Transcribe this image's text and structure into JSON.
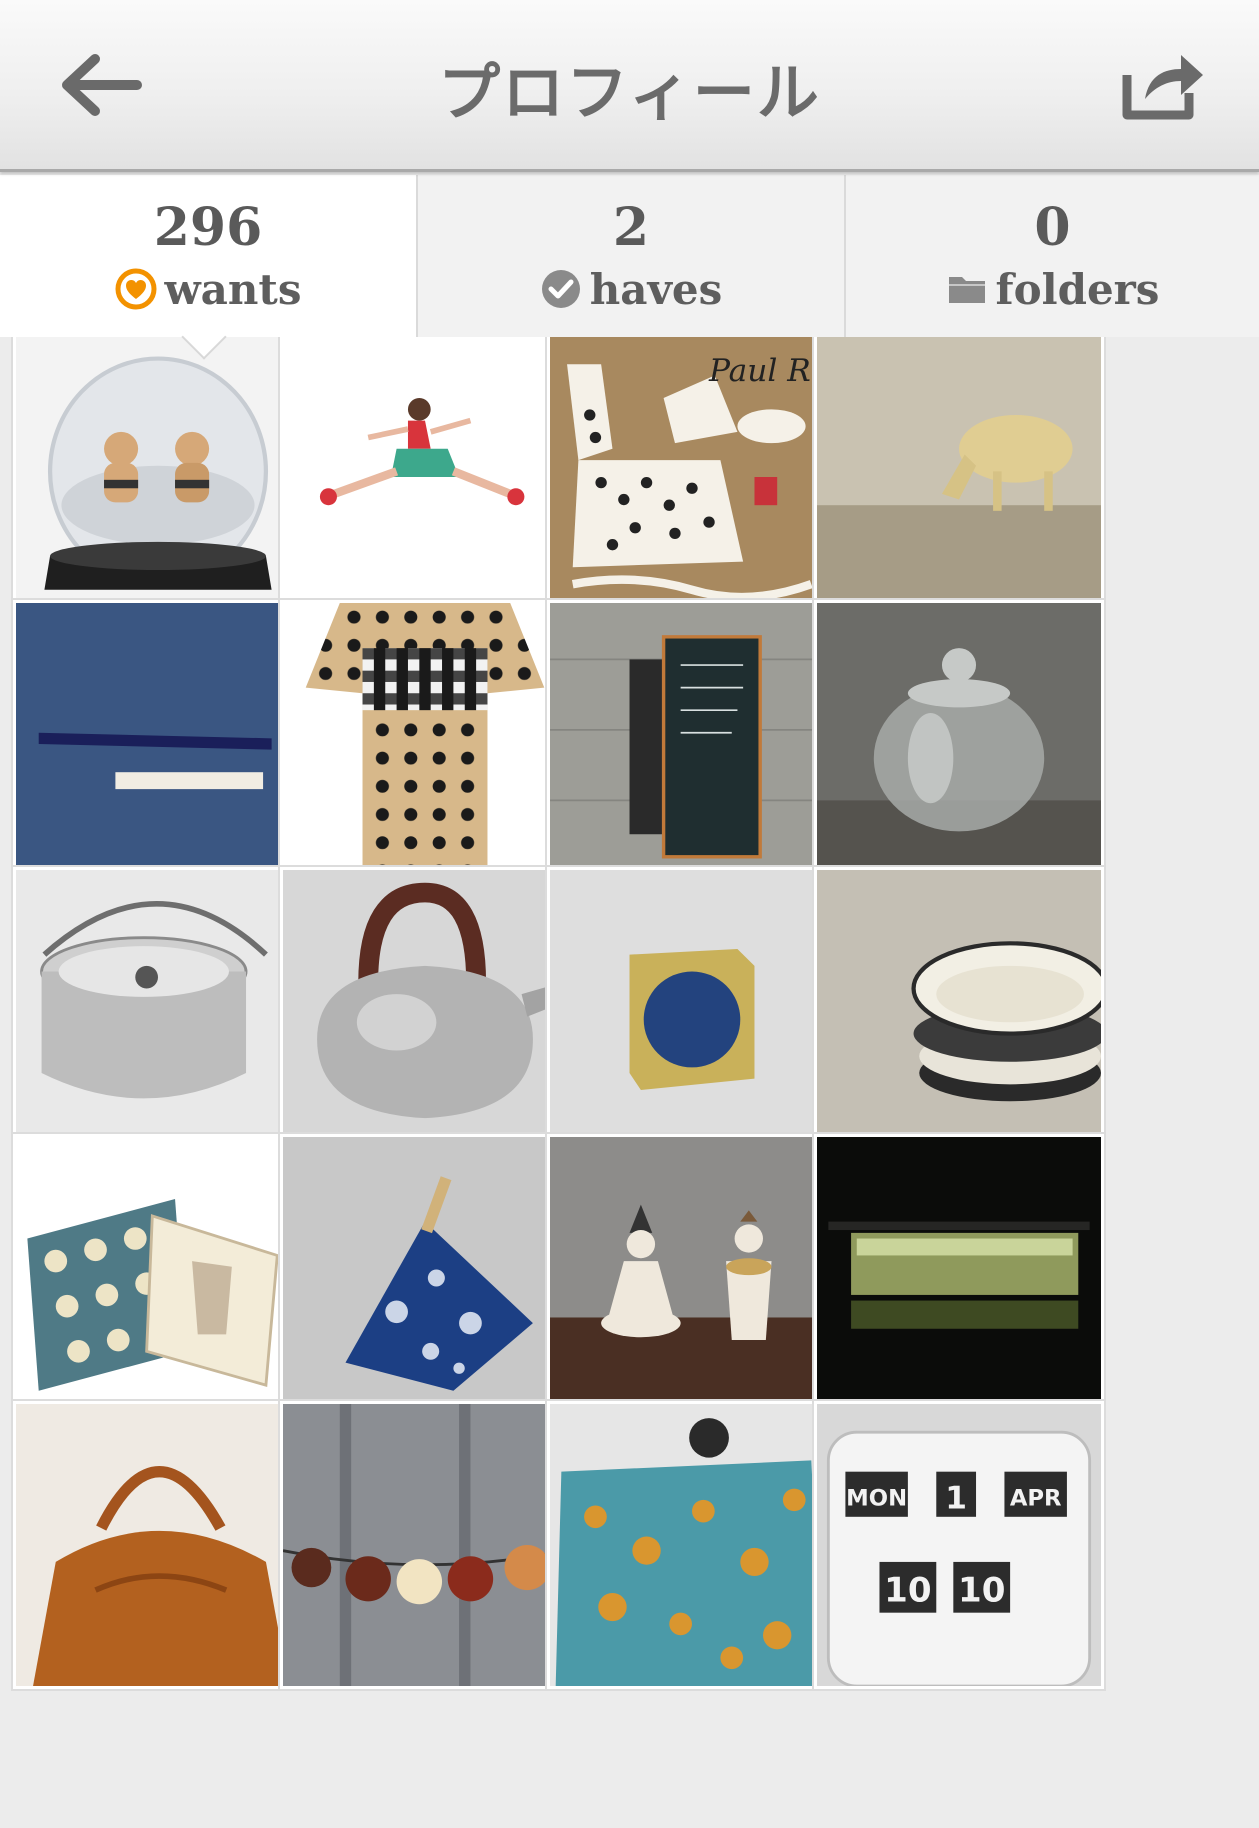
{
  "nav": {
    "title": "プロフィール",
    "back_icon": "arrow-left-icon",
    "share_icon": "share-icon"
  },
  "stats": {
    "wants": {
      "count": "296",
      "label": "wants",
      "icon": "heart-circle-icon",
      "icon_color": "#f39200"
    },
    "haves": {
      "count": "2",
      "label": "haves",
      "icon": "check-circle-icon"
    },
    "folders": {
      "count": "0",
      "label": "folders",
      "icon": "folder-icon"
    }
  },
  "tab_labels": [
    "wants",
    "haves",
    "folders"
  ],
  "grid": {
    "items": [
      {
        "subject": "snow-globe"
      },
      {
        "subject": "jumping-girl-figure"
      },
      {
        "subject": "paul-rand-art",
        "caption": "Paul Rand"
      },
      {
        "subject": "sheep-figure"
      },
      {
        "subject": "blue-pen"
      },
      {
        "subject": "polka-dot-kimono"
      },
      {
        "subject": "notebooks-pencils"
      },
      {
        "subject": "glass-jar"
      },
      {
        "subject": "aluminum-pot"
      },
      {
        "subject": "kettle"
      },
      {
        "subject": "blue-cube"
      },
      {
        "subject": "ceramic-plates"
      },
      {
        "subject": "gift-box"
      },
      {
        "subject": "pillow"
      },
      {
        "subject": "clay-figures"
      },
      {
        "subject": "window-view"
      },
      {
        "subject": "leather-bag"
      },
      {
        "subject": "string-lights"
      },
      {
        "subject": "blanket"
      },
      {
        "subject": "flip-clock",
        "clock": [
          "MON",
          "1",
          "APR",
          "10",
          "10"
        ]
      }
    ]
  }
}
